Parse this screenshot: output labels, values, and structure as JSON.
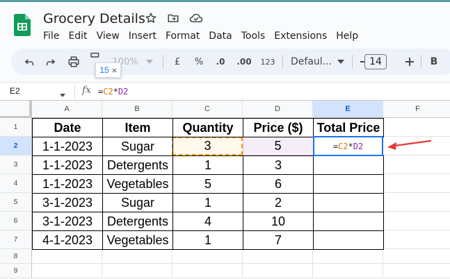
{
  "app": {
    "doc_title": "Grocery Details",
    "menu": [
      "File",
      "Edit",
      "View",
      "Insert",
      "Format",
      "Data",
      "Tools",
      "Extensions",
      "Help"
    ]
  },
  "toolbar": {
    "zoom": "100%",
    "currency": "£",
    "percent": "%",
    "dec_decrease": ".0",
    "dec_increase": ".00",
    "number_format": "123",
    "font": "Defaul...",
    "font_size": "14",
    "bold": "B",
    "tooltip_value": "15"
  },
  "formula_bar": {
    "cell_ref": "E2",
    "fx": "fx",
    "formula_parts": [
      "=",
      "C2",
      "*",
      "D2"
    ]
  },
  "grid": {
    "columns": [
      "A",
      "B",
      "C",
      "D",
      "E",
      "F"
    ],
    "selected_column": "E",
    "rows": [
      "1",
      "2",
      "3",
      "4",
      "5",
      "6",
      "7",
      "8",
      "9"
    ],
    "selected_row": "2",
    "headers": [
      "Date",
      "Item",
      "Quantity",
      "Price ($)",
      "Total Price"
    ],
    "data": [
      [
        "1-1-2023",
        "Sugar",
        "3",
        "5"
      ],
      [
        "1-1-2023",
        "Detergents",
        "1",
        "3"
      ],
      [
        "1-1-2023",
        "Vegetables",
        "5",
        "6"
      ],
      [
        "3-1-2023",
        "Sugar",
        "1",
        "2"
      ],
      [
        "3-1-2023",
        "Detergents",
        "4",
        "10"
      ],
      [
        "4-1-2023",
        "Vegetables",
        "1",
        "7"
      ]
    ]
  },
  "colors": {
    "accent": "#1a73e8",
    "ref_c2": "#e37400",
    "ref_d2": "#8e24aa",
    "arrow": "#e53935",
    "logo": "#0f9d58"
  }
}
